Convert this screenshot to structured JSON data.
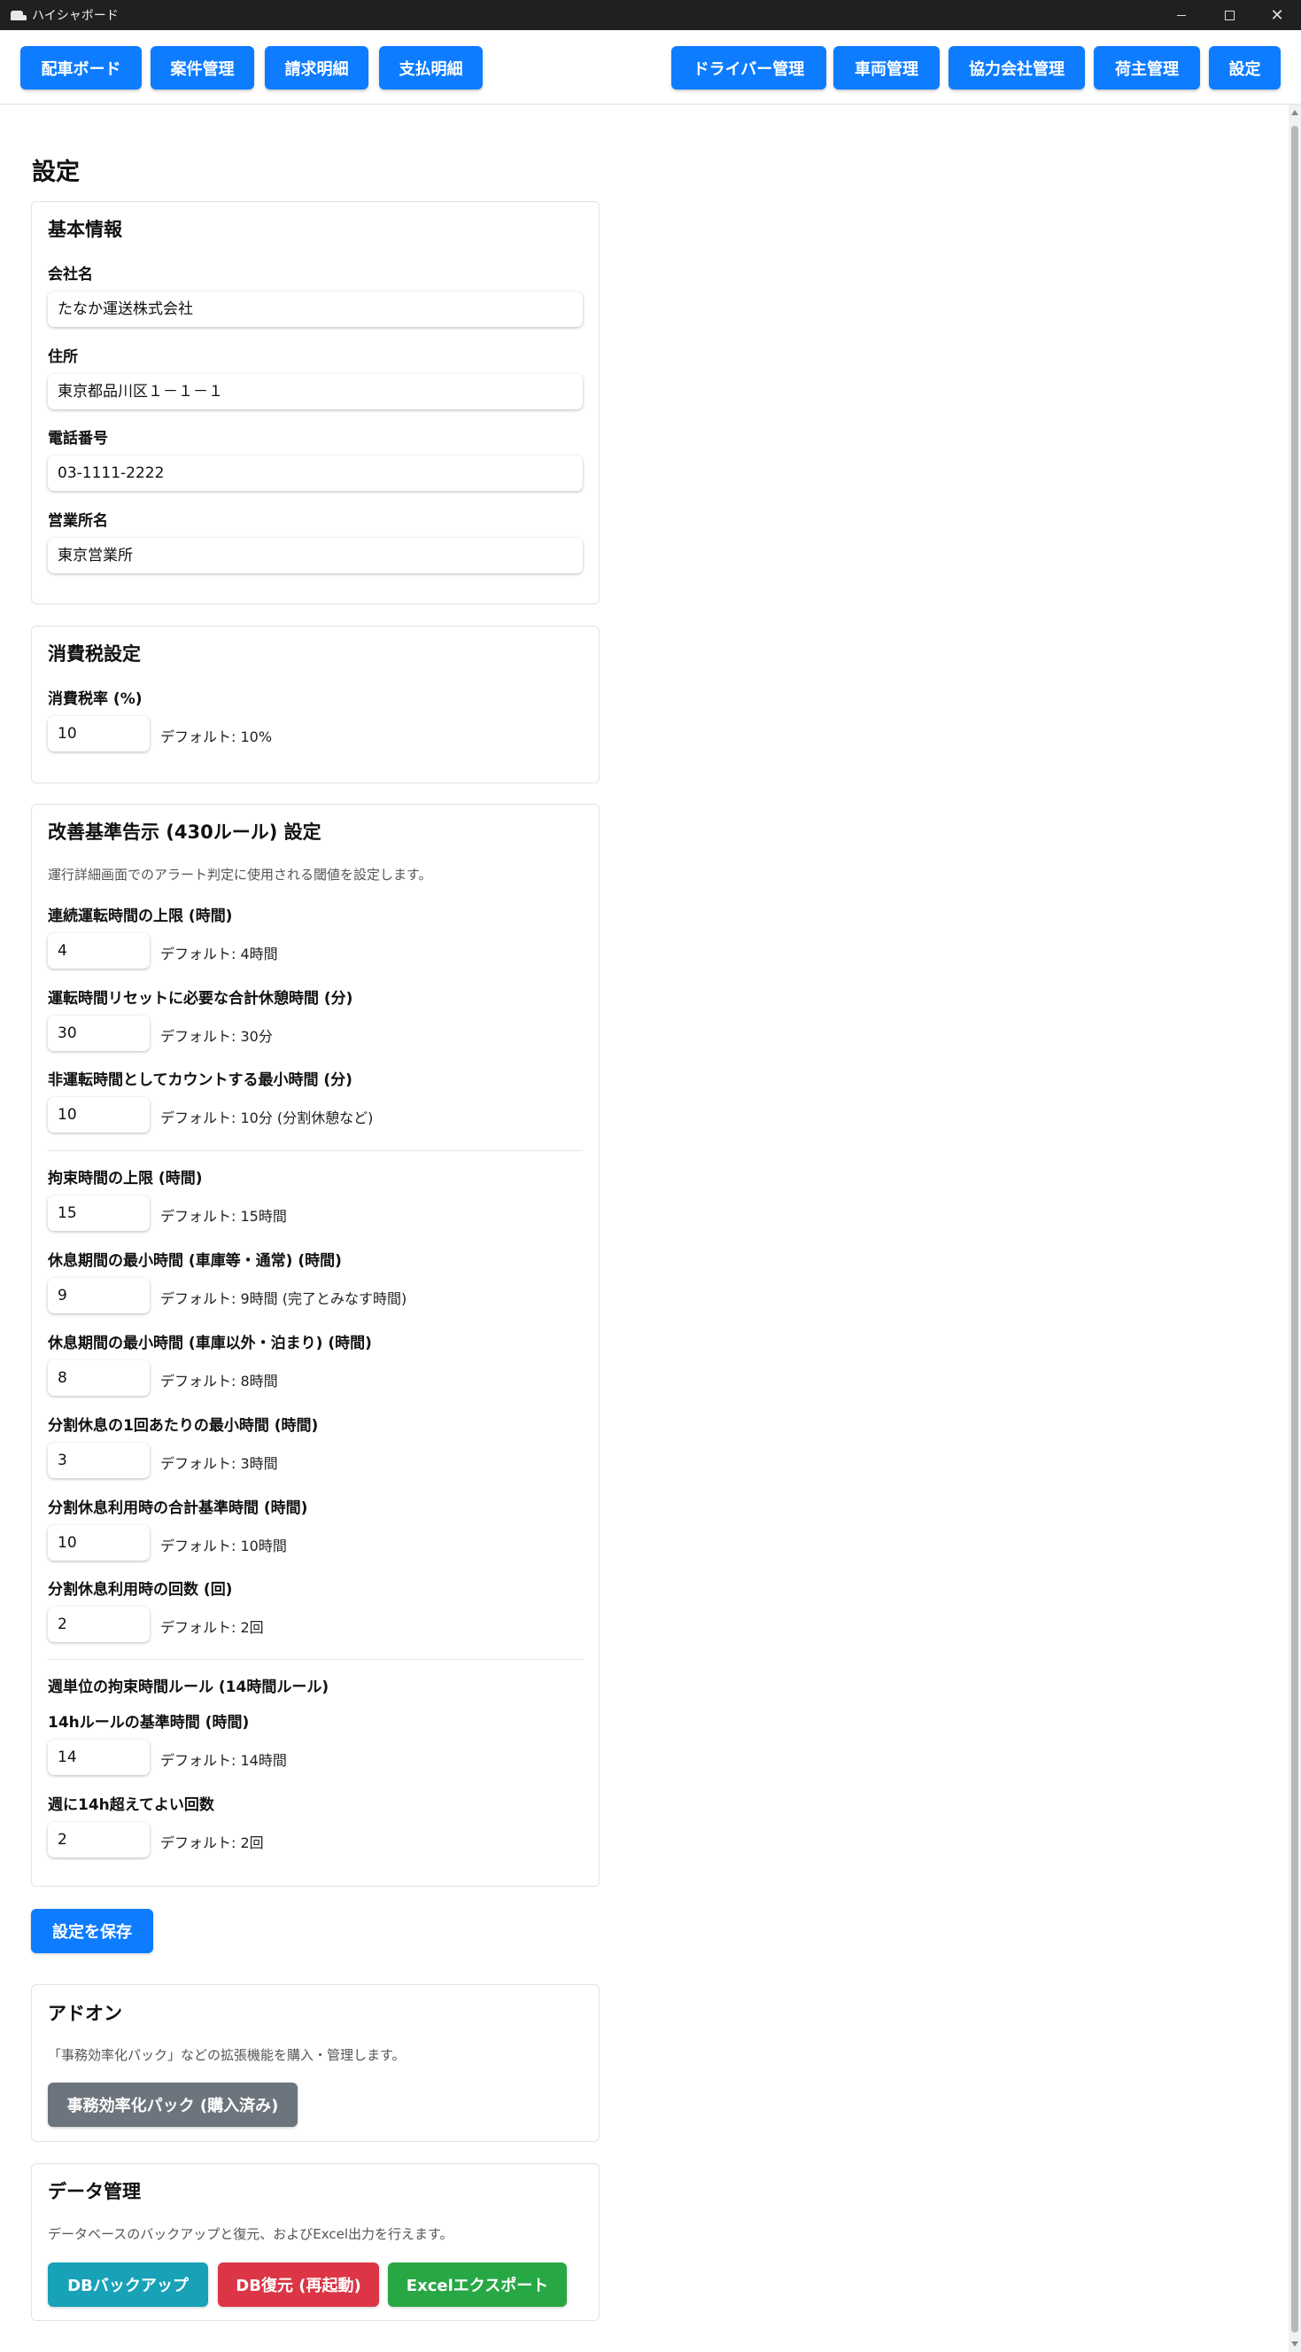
{
  "window": {
    "title": "ハイシャボード"
  },
  "nav": {
    "left": [
      "配車ボード",
      "案件管理",
      "請求明細",
      "支払明細"
    ],
    "right": [
      "ドライバー管理",
      "車両管理",
      "協力会社管理",
      "荷主管理",
      "設定"
    ]
  },
  "page": {
    "title": "設定"
  },
  "basic": {
    "title": "基本情報",
    "company_label": "会社名",
    "company_value": "たなか運送株式会社",
    "address_label": "住所",
    "address_value": "東京都品川区１－１－１",
    "phone_label": "電話番号",
    "phone_value": "03-1111-2222",
    "office_label": "営業所名",
    "office_value": "東京営業所"
  },
  "tax": {
    "title": "消費税設定",
    "rate_label": "消費税率 (%)",
    "rate_value": "10",
    "rate_hint": "デフォルト: 10%"
  },
  "rules": {
    "title": "改善基準告示 (430ルール) 設定",
    "description": "運行詳細画面でのアラート判定に使用される閾値を設定します。",
    "items": [
      {
        "label": "連続運転時間の上限 (時間)",
        "value": "4",
        "hint": "デフォルト: 4時間"
      },
      {
        "label": "運転時間リセットに必要な合計休憩時間 (分)",
        "value": "30",
        "hint": "デフォルト: 30分"
      },
      {
        "label": "非運転時間としてカウントする最小時間 (分)",
        "value": "10",
        "hint": "デフォルト: 10分 (分割休憩など)"
      },
      {
        "label": "拘束時間の上限 (時間)",
        "value": "15",
        "hint": "デフォルト: 15時間"
      },
      {
        "label": "休息期間の最小時間 (車庫等・通常) (時間)",
        "value": "9",
        "hint": "デフォルト: 9時間 (完了とみなす時間)"
      },
      {
        "label": "休息期間の最小時間 (車庫以外・泊まり) (時間)",
        "value": "8",
        "hint": "デフォルト: 8時間"
      },
      {
        "label": "分割休息の1回あたりの最小時間 (時間)",
        "value": "3",
        "hint": "デフォルト: 3時間"
      },
      {
        "label": "分割休息利用時の合計基準時間 (時間)",
        "value": "10",
        "hint": "デフォルト: 10時間"
      },
      {
        "label": "分割休息利用時の回数 (回)",
        "value": "2",
        "hint": "デフォルト: 2回"
      },
      {
        "label": "14hルールの基準時間 (時間)",
        "value": "14",
        "hint": "デフォルト: 14時間"
      },
      {
        "label": "週に14h超えてよい回数",
        "value": "2",
        "hint": "デフォルト: 2回"
      }
    ],
    "weekly_heading": "週単位の拘束時間ルール (14時間ルール)"
  },
  "save_button": "設定を保存",
  "addon": {
    "title": "アドオン",
    "description": "「事務効率化パック」などの拡張機能を購入・管理します。",
    "button": "事務効率化パック (購入済み)"
  },
  "data_mgmt": {
    "title": "データ管理",
    "description": "データベースのバックアップと復元、およびExcel出力を行えます。",
    "backup_button": "DBバックアップ",
    "restore_button": "DB復元 (再起動)",
    "export_button": "Excelエクスポート"
  },
  "colors": {
    "primary": "#0d7cff",
    "secondary": "#6c757d",
    "info": "#17a2b8",
    "danger": "#dc3545",
    "success": "#28a745"
  }
}
